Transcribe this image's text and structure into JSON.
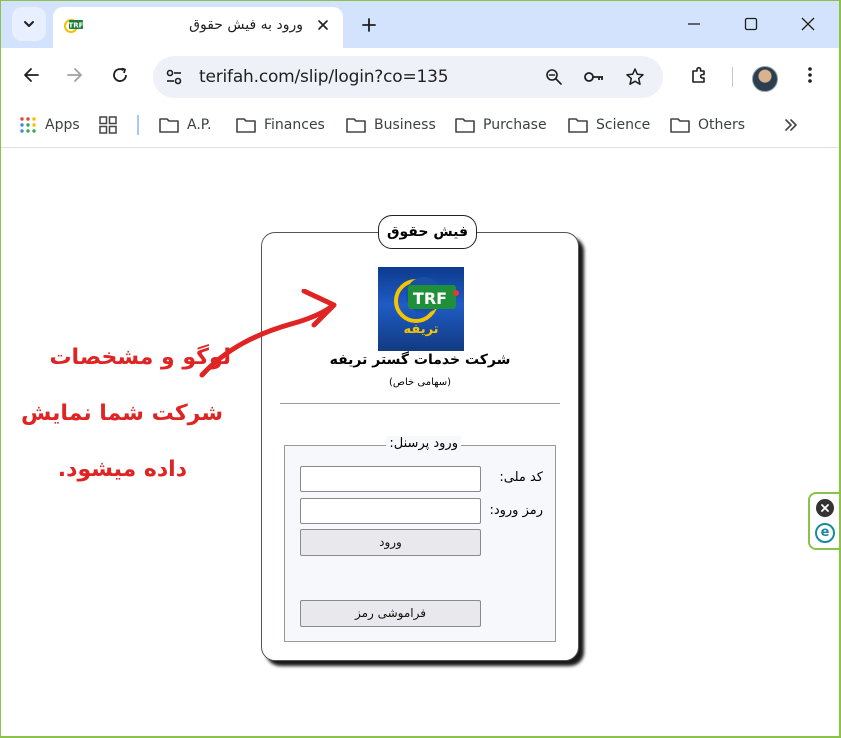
{
  "browser": {
    "tab": {
      "title": "ورود به فیش حقوق",
      "favicon_text": "TRF"
    },
    "address": {
      "url": "terifah.com/slip/login?co=135"
    },
    "bookmarks": {
      "apps_label": "Apps",
      "items": [
        "A.P.",
        "Finances",
        "Business",
        "Purchase",
        "Science",
        "Others"
      ]
    },
    "icons": {
      "tab_search": "chevron-down-icon",
      "close_tab": "close-icon",
      "new_tab": "plus-icon",
      "minimize": "minimize-icon",
      "maximize": "maximize-icon",
      "close_window": "close-icon",
      "back": "arrow-left-icon",
      "forward": "arrow-right-icon",
      "reload": "reload-icon",
      "site_info": "tune-icon",
      "zoom": "zoom-icon",
      "password": "key-icon",
      "bookmark": "star-icon",
      "extensions": "puzzle-icon",
      "menu": "more-vert-icon",
      "overflow": "chevrons-right-icon"
    }
  },
  "page": {
    "card_title": "فیش حقوق",
    "company": {
      "logo_text": "TRF",
      "logo_subtext": "تریفه",
      "name": "شرکت خدمات گستر تریفه",
      "subtitle": "(سهامی خاص)"
    },
    "login": {
      "legend": "ورود پرسنل:",
      "national_code_label": "کد ملی:",
      "national_code_value": "",
      "password_label": "رمز ورود:",
      "password_value": "",
      "submit_label": "ورود",
      "forgot_label": "فراموشی رمز"
    },
    "annotation": {
      "line1": "لوگو و مشخصات",
      "line2": "شرکت شما نمایش",
      "line3": "داده میشود.",
      "color": "#e02424"
    }
  },
  "colors": {
    "tabstrip": "#d3e3fd",
    "omnibox": "#eef1f8",
    "frame": "#8bc34a",
    "annotation_red": "#e02424"
  }
}
